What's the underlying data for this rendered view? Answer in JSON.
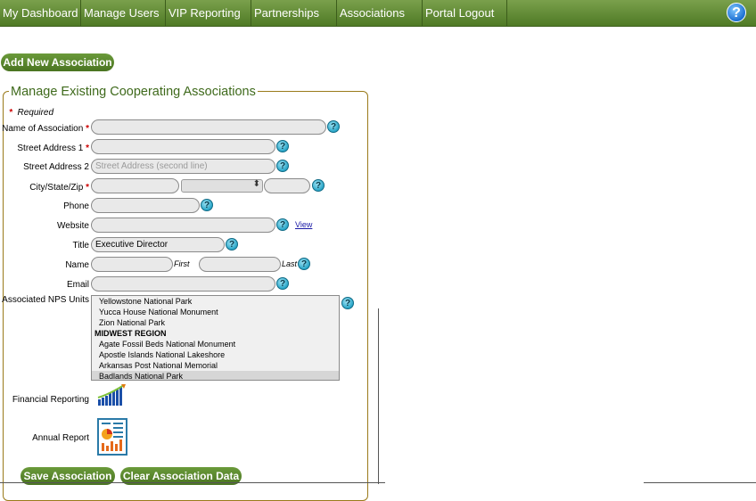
{
  "nav": {
    "items": [
      "My Dashboard",
      "Manage Users",
      "VIP Reporting",
      "Partnerships",
      "Associations",
      "Portal Logout"
    ],
    "help": "?"
  },
  "buttons": {
    "add_new": "Add New Association",
    "save": "Save Association",
    "clear": "Clear Association Data"
  },
  "section": {
    "title": "Manage Existing Cooperating Associations",
    "required_note": "Required"
  },
  "form": {
    "name_of_association": {
      "label": "Name of Association",
      "value": ""
    },
    "street1": {
      "label": "Street Address 1",
      "value": ""
    },
    "street2": {
      "label": "Street Address 2",
      "placeholder": "Street Address (second line)"
    },
    "city_state_zip": {
      "label": "City/State/Zip",
      "value": ""
    },
    "phone": {
      "label": "Phone",
      "value": ""
    },
    "website": {
      "label": "Website",
      "value": "",
      "link": "View"
    },
    "title": {
      "label": "Title",
      "value": "Executive Director"
    },
    "name": {
      "label": "Name",
      "first": "First",
      "last": "Last"
    },
    "email": {
      "label": "Email",
      "value": ""
    },
    "nps_units": {
      "label": "Associated NPS Units",
      "options": [
        {
          "text": "Yellowstone National Park",
          "type": "option"
        },
        {
          "text": "Yucca House National Monument",
          "type": "option"
        },
        {
          "text": "Zion National Park",
          "type": "option"
        },
        {
          "text": "MIDWEST REGION",
          "type": "group"
        },
        {
          "text": "Agate Fossil Beds National Monument",
          "type": "option"
        },
        {
          "text": "Apostle Islands National Lakeshore",
          "type": "option"
        },
        {
          "text": "Arkansas Post National Memorial",
          "type": "option"
        },
        {
          "text": "Badlands National Park",
          "type": "selected"
        }
      ]
    },
    "financial_reporting": {
      "label": "Financial Reporting",
      "icon": "bar-chart-icon"
    },
    "annual_report": {
      "label": "Annual Report",
      "icon": "report-document-icon"
    }
  },
  "colors": {
    "nav": "#5b8a2f",
    "accent": "#4f7a25",
    "legend": "#3f6a1c",
    "border": "#9a7a1a"
  }
}
